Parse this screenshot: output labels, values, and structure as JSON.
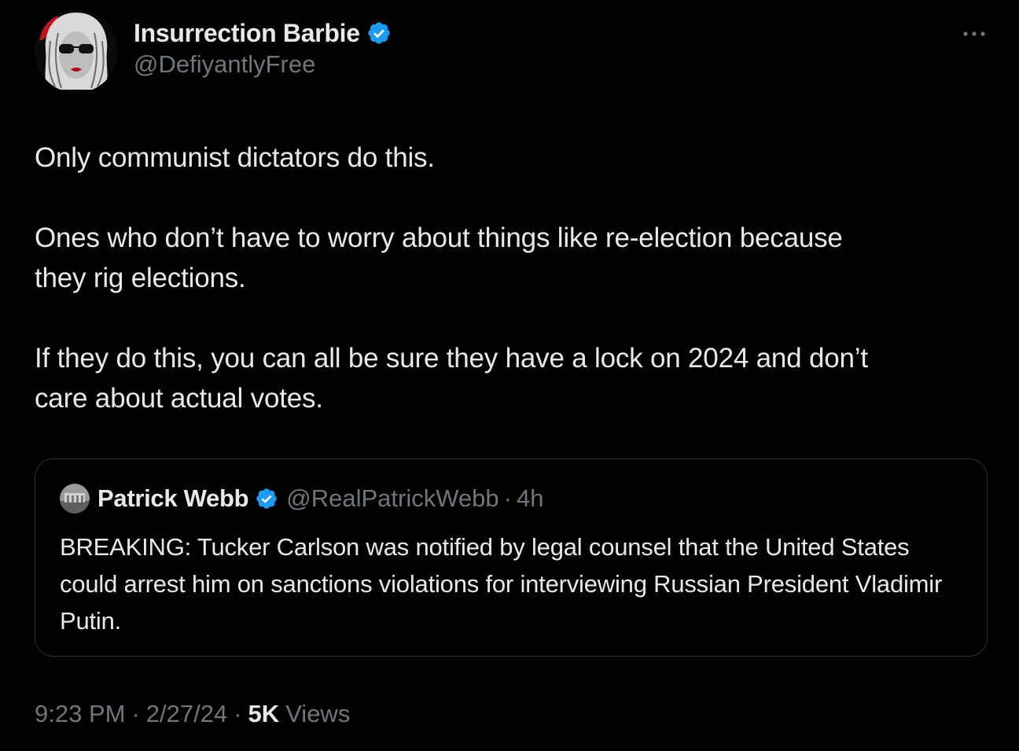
{
  "author": {
    "display_name": "Insurrection Barbie",
    "handle": "@DefiyantlyFree",
    "verified": true
  },
  "icons": {
    "verified": "verified-badge-icon",
    "more": "more-horizontal-icon"
  },
  "colors": {
    "background": "#000000",
    "primary_text": "#e7e9ea",
    "secondary_text": "#71767b",
    "verified_blue": "#1d9bf0",
    "border": "#2f3336"
  },
  "tweet": {
    "paragraphs": [
      "Only communist dictators do this.",
      "Ones who don’t have to worry about things like re-election because\nthey rig elections.",
      "If they do this, you can all be sure they have a lock on 2024 and don’t\ncare about actual votes."
    ]
  },
  "quote": {
    "display_name": "Patrick Webb",
    "handle": "@RealPatrickWebb",
    "separator": "·",
    "time": "4h",
    "verified": true,
    "text": "BREAKING: Tucker Carlson was notified by legal counsel that the United States could arrest him on sanctions violations for interviewing Russian President Vladimir Putin."
  },
  "meta": {
    "time": "9:23 PM",
    "separator": "·",
    "date": "2/27/24",
    "views_count": "5K",
    "views_label": "Views"
  }
}
